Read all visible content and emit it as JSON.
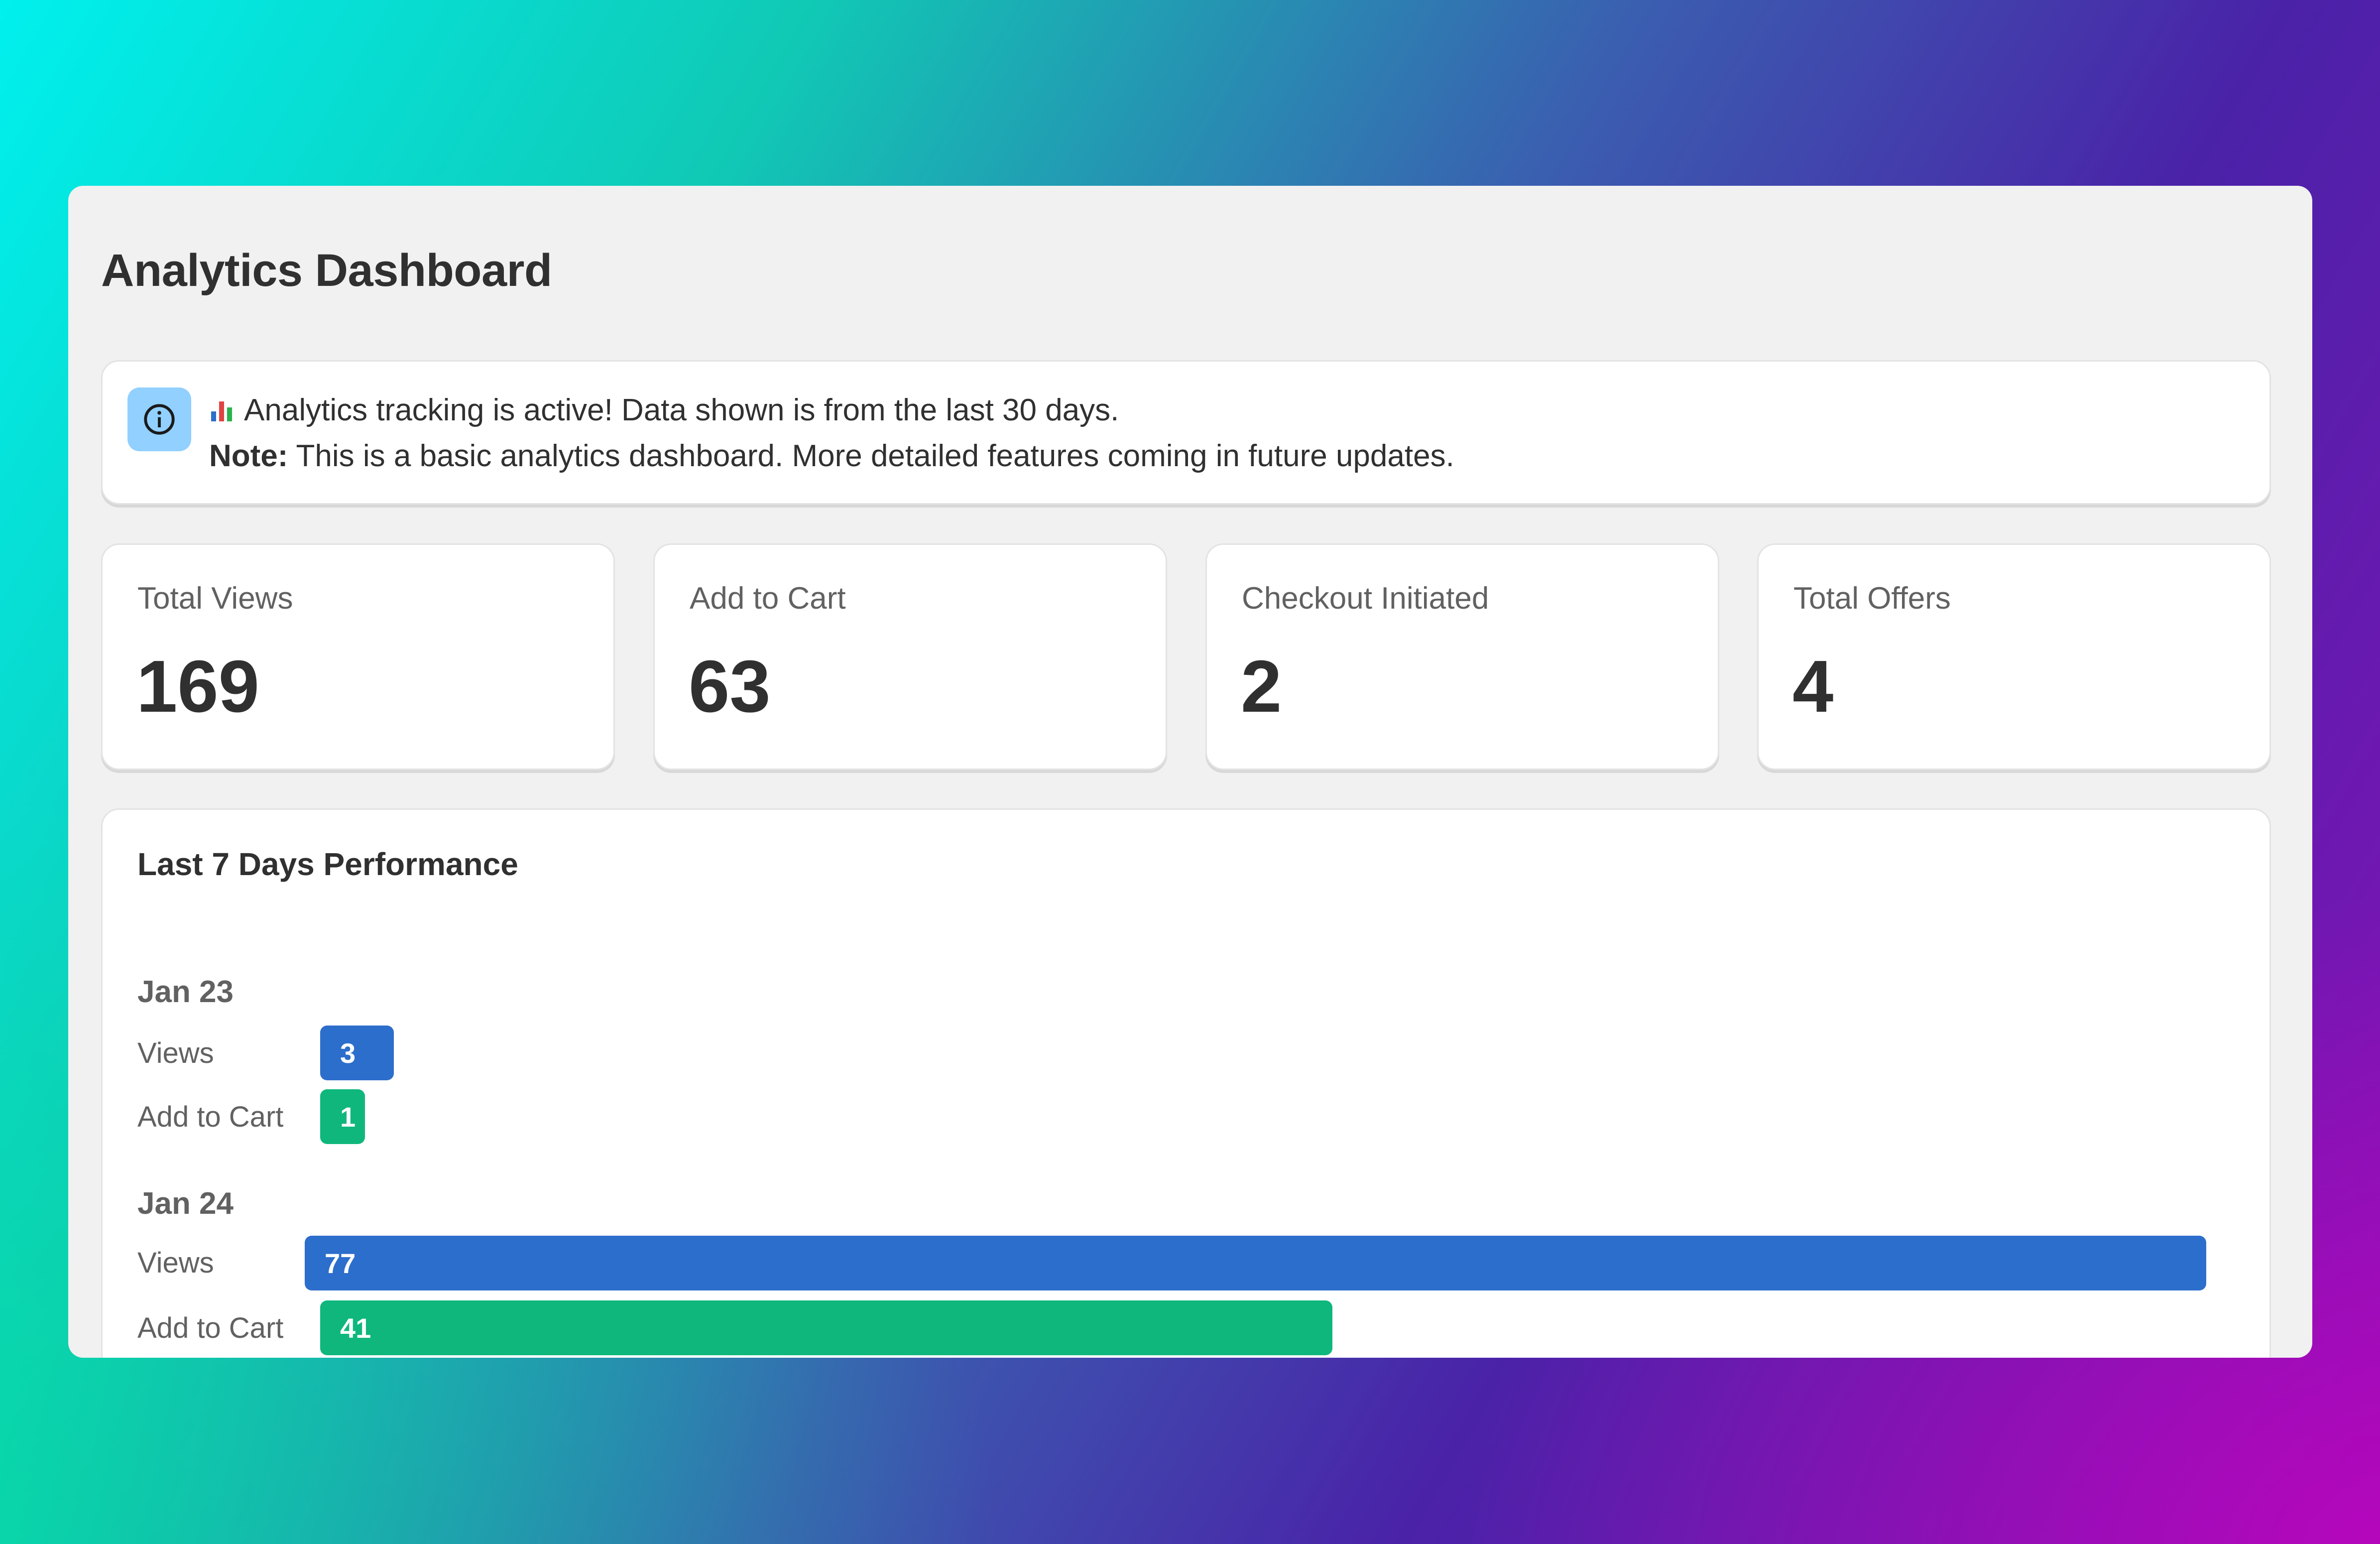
{
  "page": {
    "title": "Analytics Dashboard"
  },
  "banner": {
    "icon": "info-icon",
    "emoji": "bar-chart-emoji",
    "line1": "Analytics tracking is active! Data shown is from the last 30 days.",
    "note_label": "Note:",
    "note_text": " This is a basic analytics dashboard. More detailed features coming in future updates."
  },
  "stats": [
    {
      "label": "Total Views",
      "value": "169"
    },
    {
      "label": "Add to Cart",
      "value": "63"
    },
    {
      "label": "Checkout Initiated",
      "value": "2"
    },
    {
      "label": "Total Offers",
      "value": "4"
    }
  ],
  "performance": {
    "title": "Last 7 Days Performance",
    "views_label": "Views",
    "cart_label": "Add to Cart",
    "days": [
      {
        "date": "Jan 23",
        "views": 3,
        "add_to_cart": 1
      },
      {
        "date": "Jan 24",
        "views": 77,
        "add_to_cart": 41
      }
    ]
  },
  "colors": {
    "views_bar": "#2c6ecb",
    "cart_bar": "#0fb77d",
    "info_icon_bg": "#91d0ff"
  }
}
